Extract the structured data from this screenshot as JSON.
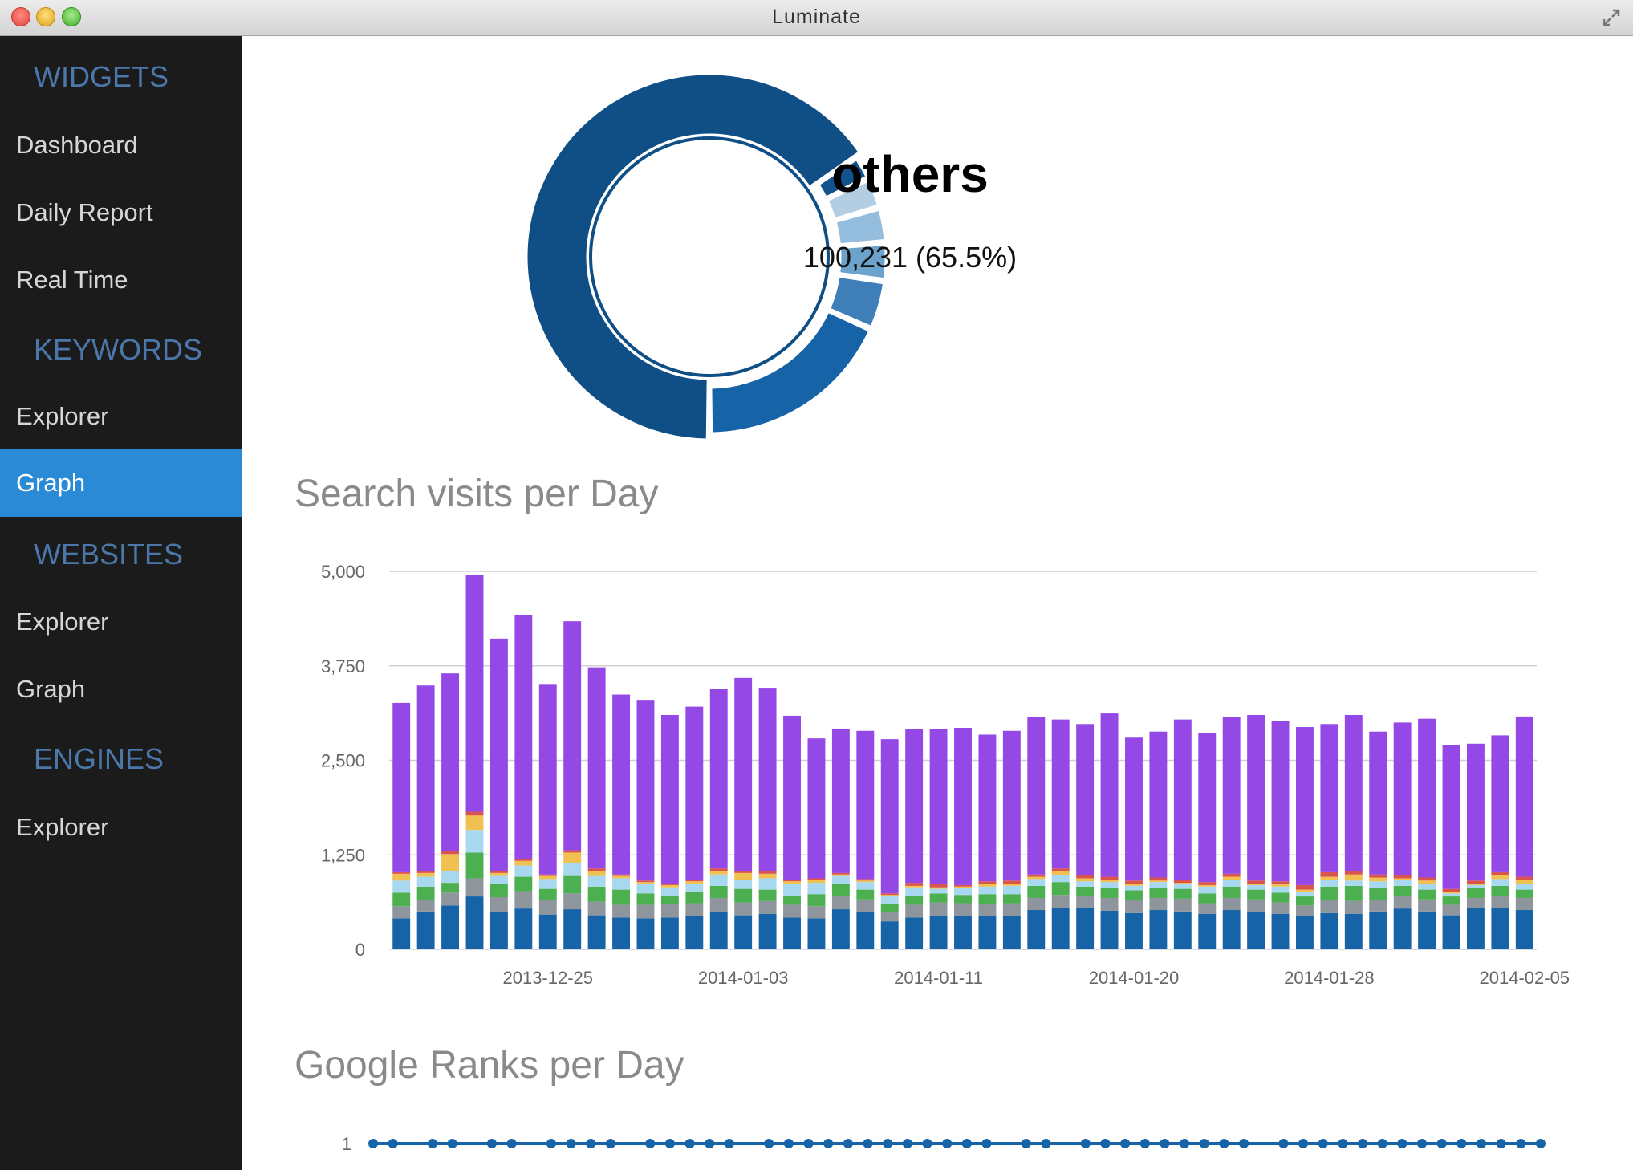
{
  "window": {
    "title": "Luminate"
  },
  "sidebar": {
    "sections": [
      {
        "title": "WIDGETS",
        "items": [
          "Dashboard",
          "Daily Report",
          "Real Time"
        ]
      },
      {
        "title": "KEYWORDS",
        "items": [
          "Explorer",
          "Graph"
        ]
      },
      {
        "title": "WEBSITES",
        "items": [
          "Explorer",
          "Graph"
        ]
      },
      {
        "title": "ENGINES",
        "items": [
          "Explorer"
        ]
      }
    ],
    "active_item": "KEYWORDS/Graph"
  },
  "donut": {
    "label": "others",
    "value_text": "100,231 (65.5%)",
    "highlighted_segment": "others",
    "segments": [
      {
        "value": 65.5,
        "color": "#0f4f86"
      },
      {
        "value": 2.2,
        "color": "#12538d"
      },
      {
        "value": 2.8,
        "color": "#b3cde3"
      },
      {
        "value": 3.2,
        "color": "#94bcdc"
      },
      {
        "value": 3.5,
        "color": "#6ba3cc"
      },
      {
        "value": 4.5,
        "color": "#3e7fb9"
      },
      {
        "value": 18.3,
        "color": "#1763a8"
      }
    ]
  },
  "visits_chart": {
    "title": "Search visits per Day"
  },
  "ranks_chart": {
    "title": "Google Ranks per Day"
  },
  "chart_data": [
    {
      "type": "bar",
      "stacked": true,
      "title": "Search visits per Day",
      "y_ticks": [
        "5,000",
        "3,750",
        "2,500",
        "1,250",
        "0"
      ],
      "ylim": [
        0,
        5000
      ],
      "grid": true,
      "x_tick_labels": [
        {
          "label": "2013-12-25",
          "index": 6
        },
        {
          "label": "2014-01-03",
          "index": 14
        },
        {
          "label": "2014-01-11",
          "index": 22
        },
        {
          "label": "2014-01-20",
          "index": 30
        },
        {
          "label": "2014-01-28",
          "index": 38
        },
        {
          "label": "2014-02-05",
          "index": 46
        }
      ],
      "series_colors": [
        "#1763a8",
        "#8f959c",
        "#4caf50",
        "#a8d8f0",
        "#f0c050",
        "#d9534f",
        "#9448e6"
      ],
      "totals": [
        3260,
        3490,
        3650,
        4950,
        4110,
        4420,
        3510,
        4340,
        3730,
        3370,
        3300,
        3100,
        3210,
        3440,
        3590,
        3460,
        3090,
        2790,
        2920,
        2890,
        2780,
        2910,
        2910,
        2930,
        2840,
        2890,
        3070,
        3040,
        2980,
        3120,
        2800,
        2880,
        3040,
        2860,
        3070,
        3100,
        3020,
        2940,
        2980,
        3100,
        2880,
        3000,
        3050,
        2700,
        2720,
        2830,
        3080
      ],
      "series": [
        {
          "values": [
            410,
            500,
            580,
            700,
            490,
            540,
            460,
            530,
            450,
            420,
            410,
            420,
            440,
            490,
            450,
            470,
            420,
            410,
            530,
            490,
            370,
            420,
            440,
            440,
            440,
            440,
            520,
            550,
            550,
            510,
            480,
            520,
            500,
            470,
            520,
            490,
            470,
            440,
            480,
            470,
            500,
            540,
            500,
            450,
            550,
            550,
            520
          ]
        },
        {
          "values": [
            160,
            150,
            170,
            240,
            200,
            230,
            190,
            210,
            180,
            170,
            180,
            180,
            170,
            190,
            170,
            170,
            170,
            160,
            170,
            170,
            120,
            170,
            180,
            170,
            160,
            170,
            160,
            170,
            160,
            170,
            170,
            160,
            170,
            140,
            160,
            170,
            150,
            140,
            170,
            170,
            150,
            170,
            160,
            140,
            130,
            160,
            160
          ]
        },
        {
          "values": [
            180,
            180,
            130,
            340,
            170,
            190,
            150,
            230,
            200,
            200,
            150,
            110,
            150,
            160,
            180,
            150,
            120,
            160,
            160,
            130,
            110,
            120,
            120,
            110,
            130,
            120,
            160,
            170,
            120,
            130,
            130,
            130,
            130,
            130,
            150,
            130,
            130,
            120,
            180,
            200,
            160,
            130,
            130,
            110,
            130,
            130,
            110
          ]
        },
        {
          "values": [
            160,
            130,
            160,
            300,
            110,
            150,
            130,
            170,
            140,
            150,
            120,
            110,
            110,
            150,
            120,
            150,
            150,
            150,
            110,
            100,
            100,
            110,
            60,
            90,
            100,
            110,
            90,
            90,
            70,
            80,
            60,
            80,
            60,
            90,
            90,
            60,
            80,
            60,
            90,
            70,
            90,
            80,
            80,
            40,
            40,
            90,
            80
          ]
        },
        {
          "values": [
            90,
            50,
            220,
            190,
            40,
            60,
            40,
            140,
            70,
            30,
            30,
            30,
            30,
            50,
            90,
            60,
            40,
            40,
            20,
            20,
            20,
            20,
            20,
            20,
            30,
            30,
            30,
            60,
            40,
            30,
            30,
            20,
            20,
            20,
            40,
            20,
            30,
            30,
            40,
            80,
            50,
            20,
            40,
            20,
            20,
            50,
            50
          ]
        },
        {
          "values": [
            20,
            30,
            40,
            50,
            20,
            20,
            20,
            30,
            30,
            20,
            20,
            20,
            20,
            30,
            30,
            30,
            20,
            20,
            20,
            20,
            20,
            40,
            40,
            20,
            40,
            40,
            30,
            30,
            40,
            40,
            40,
            40,
            40,
            40,
            40,
            40,
            40,
            60,
            60,
            40,
            40,
            40,
            40,
            40,
            40,
            40,
            40
          ]
        },
        {
          "values": [
            2240,
            2450,
            2350,
            3130,
            3080,
            3230,
            2520,
            3030,
            2660,
            2380,
            2390,
            2230,
            2290,
            2370,
            2550,
            2430,
            2170,
            1850,
            1910,
            1960,
            2040,
            2030,
            2050,
            2080,
            1940,
            1980,
            2080,
            1970,
            2000,
            2160,
            1890,
            1930,
            2120,
            1970,
            2070,
            2190,
            2120,
            2090,
            1960,
            2070,
            1890,
            2020,
            2100,
            1900,
            1810,
            1810,
            2120
          ]
        }
      ]
    },
    {
      "type": "line",
      "title": "Google Ranks per Day",
      "y_ticks": [
        "1"
      ],
      "values": [
        1,
        1,
        1,
        1,
        1,
        1,
        1,
        1,
        1,
        1,
        1,
        1,
        1,
        1,
        1,
        1,
        1,
        1,
        1,
        1,
        1,
        1,
        1,
        1,
        1,
        1,
        1,
        1,
        1,
        1,
        1,
        1,
        1,
        1,
        1,
        1,
        1,
        1,
        1,
        1,
        1,
        1,
        1,
        1,
        1,
        1,
        1,
        1,
        1,
        1,
        1,
        1,
        1,
        1,
        1,
        1,
        1,
        1,
        1,
        1
      ],
      "gaps_after": [
        2,
        5,
        8,
        13,
        19,
        32,
        35,
        45
      ],
      "color": "#1763a8"
    }
  ]
}
